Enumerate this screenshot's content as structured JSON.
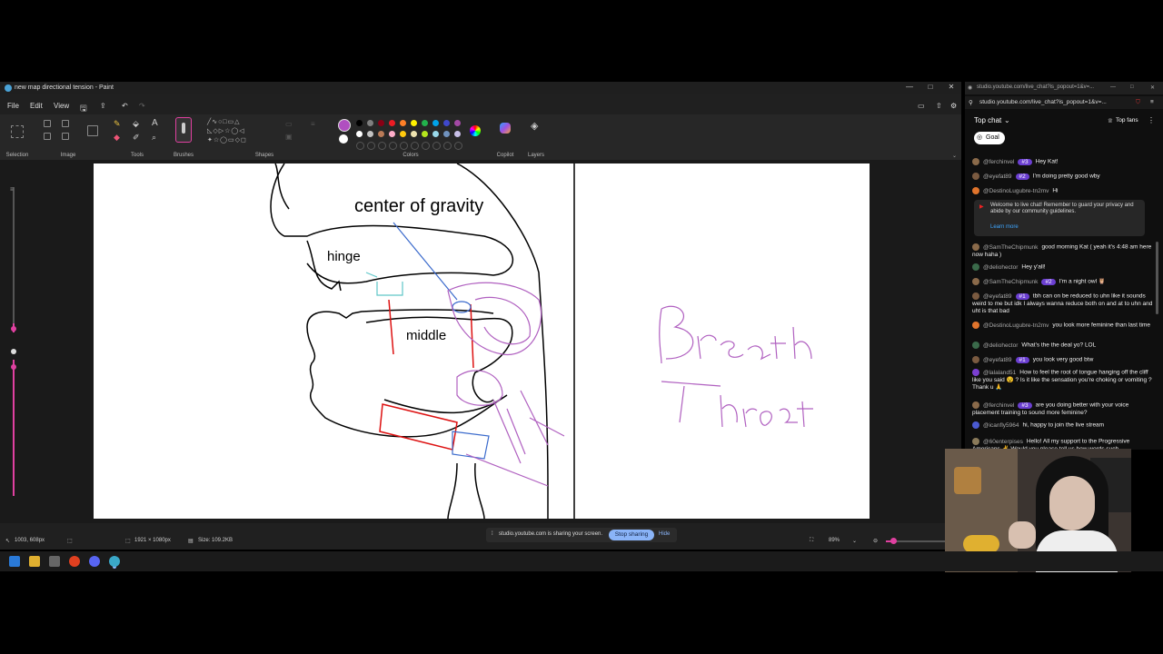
{
  "window": {
    "title": "new map directional tension - Paint",
    "controls": [
      "—",
      "□",
      "✕"
    ]
  },
  "menu": {
    "file": "File",
    "edit": "Edit",
    "view": "View"
  },
  "ribbon": {
    "groups": {
      "selection": "Selection",
      "image": "Image",
      "tools": "Tools",
      "brushes": "Brushes",
      "shapes": "Shapes",
      "colors": "Colors",
      "copilot": "Copilot",
      "layers": "Layers"
    },
    "palette": [
      "#000000",
      "#7f7f7f",
      "#880015",
      "#ed1c24",
      "#ff7f27",
      "#fff200",
      "#22b14c",
      "#00a2e8",
      "#3f48cc",
      "#a349a4",
      "#ffffff",
      "#c3c3c3",
      "#b97a57",
      "#ffaec9",
      "#ffc90e",
      "#efe4b0",
      "#b5e61d",
      "#99d9ea",
      "#7092be",
      "#c8bfe7"
    ],
    "active_color": "#b04fc0",
    "accent": "#e040a0"
  },
  "canvas_text": {
    "center_of_gravity": "center of gravity",
    "hinge": "hinge",
    "middle": "middle",
    "breath": "Breath",
    "throat": "Throat"
  },
  "status": {
    "cursor": "1003, 608px",
    "dimensions": "1921 × 1080px",
    "size": "Size: 109.2KB",
    "zoom": "89%"
  },
  "share": {
    "message": "studio.youtube.com is sharing your screen.",
    "stop": "Stop sharing",
    "hide": "Hide"
  },
  "chat": {
    "tab_url": "studio.youtube.com/live_chat?is_popout=1&v=...",
    "url": "studio.youtube.com/live_chat?is_popout=1&v=...",
    "mode": "Top chat",
    "top_fans": "Top fans",
    "goal": "Goal",
    "welcome": "Welcome to live chat! Remember to guard your privacy and abide by our community guidelines.",
    "learn_more": "Learn more",
    "messages": [
      {
        "user": "@ferchinvel",
        "badge": "#3",
        "text": "Hey Kat!",
        "color": "#8a6a4a"
      },
      {
        "user": "@eyefat89",
        "badge": "#2",
        "text": "I'm doing pretty good wby",
        "color": "#7a5a40"
      },
      {
        "user": "@DestinoLugubre-tn2mv",
        "badge": "",
        "text": "Hi",
        "color": "#e0742c"
      },
      {
        "user": "@SamTheChipmunk",
        "badge": "",
        "text": "good morning Kat ( yeah it's 4:48 am here now haha )",
        "color": "#8a6a4a"
      },
      {
        "user": "@deliohector",
        "badge": "",
        "text": "Hey y'all!",
        "color": "#3a6a4a"
      },
      {
        "user": "@SamTheChipmunk",
        "badge": "#2",
        "text": "I'm a night owl 🦉",
        "color": "#8a6a4a"
      },
      {
        "user": "@eyefat89",
        "badge": "#1",
        "text": "tbh can on be reduced to uhn like it sounds weird to me but idk I always wanna reduce both on and at to uhn and uht is that bad",
        "color": "#7a5a40"
      },
      {
        "user": "@DestinoLugubre-tn2mv",
        "badge": "",
        "text": "you look more feminine than last time",
        "color": "#e0742c"
      },
      {
        "user": "@deliohector",
        "badge": "",
        "text": "What's the the deal yo? LOL",
        "color": "#3a6a4a"
      },
      {
        "user": "@eyefat89",
        "badge": "#1",
        "text": "you look very good btw",
        "color": "#7a5a40"
      },
      {
        "user": "@lalaland51",
        "badge": "",
        "text": "How to feel the root of tongue hanging off the cliff like you said 😵 ? Is it like the sensation you're choking or vomiting ? Thank u 🙏",
        "color": "#7b3fd1"
      },
      {
        "user": "@ferchinvel",
        "badge": "#3",
        "text": "are you doing better with your voice placement training to sound more feminine?",
        "color": "#8a6a4a"
      },
      {
        "user": "@icanfly5964",
        "badge": "",
        "text": "hi, happy to join the live stream",
        "color": "#4a5ad1"
      },
      {
        "user": "@60enterpises",
        "badge": "",
        "text": "Hello! All my support to the Progressive Americans ✌ Would you please tell us how words such",
        "color": "#8a7a5a"
      }
    ]
  }
}
